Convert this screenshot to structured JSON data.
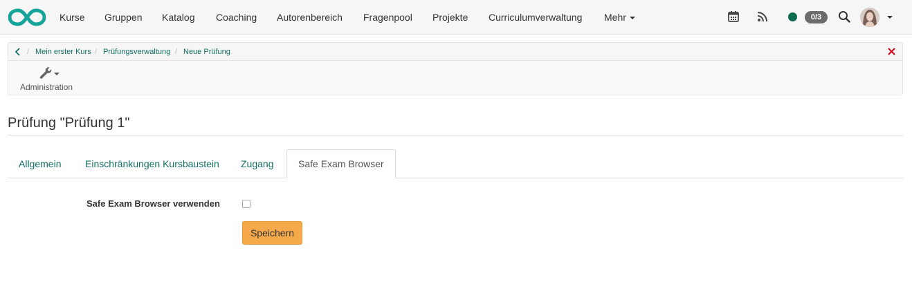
{
  "navbar": {
    "items": [
      {
        "label": "Kurse"
      },
      {
        "label": "Gruppen"
      },
      {
        "label": "Katalog"
      },
      {
        "label": "Coaching"
      },
      {
        "label": "Autorenbereich"
      },
      {
        "label": "Fragenpool"
      },
      {
        "label": "Projekte"
      },
      {
        "label": "Curriculumverwaltung"
      },
      {
        "label": "Mehr"
      }
    ],
    "icons": [
      "calendar-icon",
      "rss-icon",
      "search-icon"
    ],
    "status_color": "#0d6b4f",
    "notification_count": "0/3"
  },
  "breadcrumb": {
    "items": [
      "Mein erster Kurs",
      "Prüfungsverwaltung",
      "Neue Prüfung"
    ]
  },
  "toolbar": {
    "admin_label": "Administration"
  },
  "page": {
    "title": "Prüfung \"Prüfung 1\""
  },
  "tabs": [
    {
      "label": "Allgemein",
      "active": false
    },
    {
      "label": "Einschränkungen Kursbaustein",
      "active": false
    },
    {
      "label": "Zugang",
      "active": false
    },
    {
      "label": "Safe Exam Browser",
      "active": true
    }
  ],
  "form": {
    "seb_label": "Safe Exam Browser verwenden",
    "seb_checked": false,
    "save_label": "Speichern"
  },
  "colors": {
    "accent": "#136e63",
    "primary_button": "#f5a94a",
    "close": "#d0021b"
  }
}
